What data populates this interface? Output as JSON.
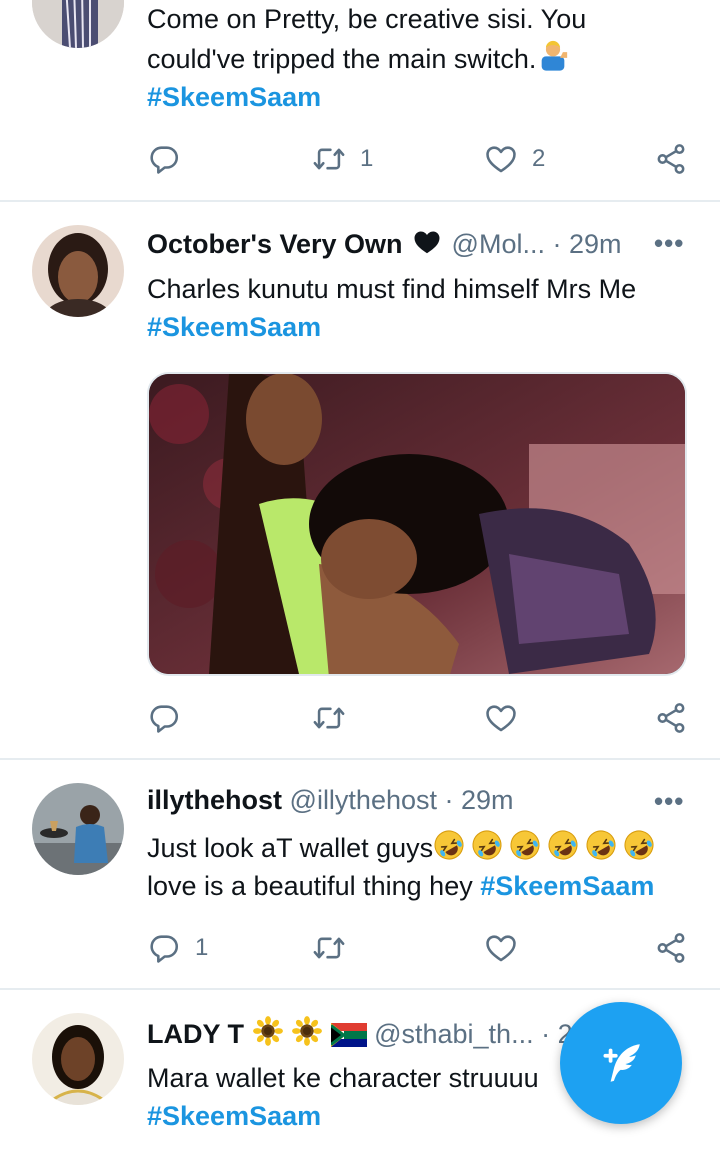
{
  "tweets": [
    {
      "text_line1": "Come on Pretty, be creative sisi. You",
      "text_line2": "could've tripped the main switch.",
      "hashtag": "#SkeemSaam",
      "retweets": "1",
      "likes": "2",
      "replies": ""
    },
    {
      "name": "October's Very Own",
      "handle": "@Mol...",
      "time": "· 29m",
      "text_line1": "Charles kunutu must find himself Mrs Me",
      "hashtag": "#SkeemSaam",
      "replies": "",
      "retweets": "",
      "likes": ""
    },
    {
      "name": "illythehost",
      "handle": "@illythehost",
      "time": "· 29m",
      "text_line1": "Just look aT wallet guys",
      "text_line2": "love is a beautiful thing hey",
      "hashtag": "#SkeemSaam",
      "replies": "1",
      "retweets": "",
      "likes": ""
    },
    {
      "name": "LADY T",
      "handle": "@sthabi_th...",
      "time": "· 2",
      "text_line1": "Mara wallet ke character struuuu",
      "hashtag": "#SkeemSaam"
    }
  ],
  "more_label": "•••",
  "colors": {
    "accent": "#1da1f2",
    "hashtag": "#1b95e0",
    "muted": "#5b7083",
    "divider": "#e6ecf0"
  },
  "icons": [
    "reply-icon",
    "retweet-icon",
    "like-icon",
    "share-icon",
    "heart-emoji",
    "sunflower-emoji",
    "south-africa-flag-emoji",
    "rofl-emoji",
    "person-tipping-hand-emoji",
    "compose-tweet-icon"
  ]
}
